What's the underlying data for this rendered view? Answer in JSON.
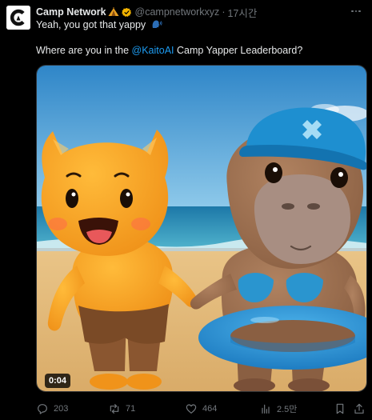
{
  "tweet": {
    "display_name": "Camp Network",
    "handle": "@campnetworkxyz",
    "separator": "·",
    "time": "17시간",
    "line1_text": "Yeah, you got that yappy",
    "line1_emoji_icon": "speaking-head-icon",
    "line2_prefix": "Where are you in the ",
    "line2_mention": "@KaitoAI",
    "line2_suffix": " Camp Yapper Leaderboard?"
  },
  "media": {
    "type": "video",
    "duration": "0:04"
  },
  "actions": {
    "replies": "203",
    "reposts": "71",
    "likes": "464",
    "views": "2.5만"
  },
  "colors": {
    "background": "#000000",
    "text": "#e7e9ea",
    "muted": "#71767b",
    "link": "#1d9bf0",
    "verified": "#f4b400"
  }
}
